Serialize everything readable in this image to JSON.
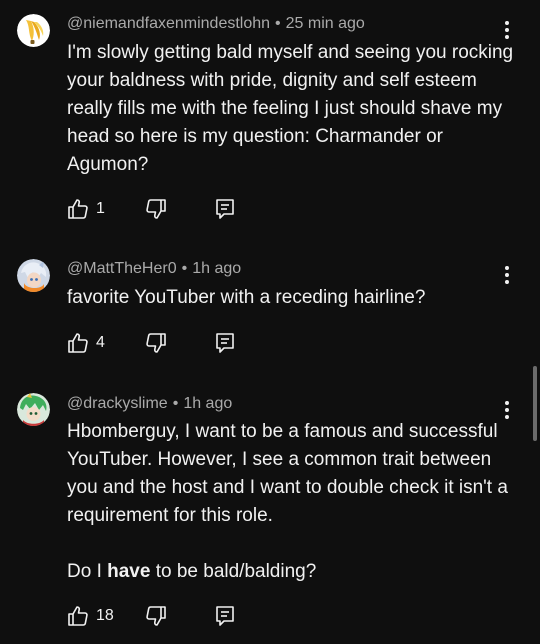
{
  "comments": [
    {
      "handle": "@niemandfaxenmindestlohn",
      "separator": "•",
      "time": "25 min ago",
      "paragraphs": [
        "I'm slowly getting bald myself and seeing you rocking your baldness with pride, dignity and self esteem really fills me with the feeling I just should shave my head so here is my question: Charmander or Agumon?"
      ],
      "likes": "1",
      "avatar_icon": "banana-avatar-icon"
    },
    {
      "handle": "@MattTheHer0",
      "separator": "•",
      "time": "1h ago",
      "paragraphs": [
        "favorite YouTuber with a receding hairline?"
      ],
      "likes": "4",
      "avatar_icon": "anime-character-avatar-icon"
    },
    {
      "handle": "@drackyslime",
      "separator": "•",
      "time": "1h ago",
      "paragraphs": [
        "Hbomberguy, I want to be a famous and successful YouTuber. However, I see a common trait between you and the host and I want to double check it isn't a requirement for this role."
      ],
      "last_paragraph": {
        "before": "Do I ",
        "bold": "have",
        "after": " to be bald/balding?"
      },
      "likes": "18",
      "avatar_icon": "green-haired-character-avatar-icon"
    }
  ],
  "icons": {
    "like": "thumbs-up-icon",
    "dislike": "thumbs-down-icon",
    "reply": "reply-icon",
    "menu": "more-vertical-icon"
  },
  "colors": {
    "background": "#0f0f0f",
    "text": "#f1f1f1",
    "secondary": "#aaaaaa"
  }
}
